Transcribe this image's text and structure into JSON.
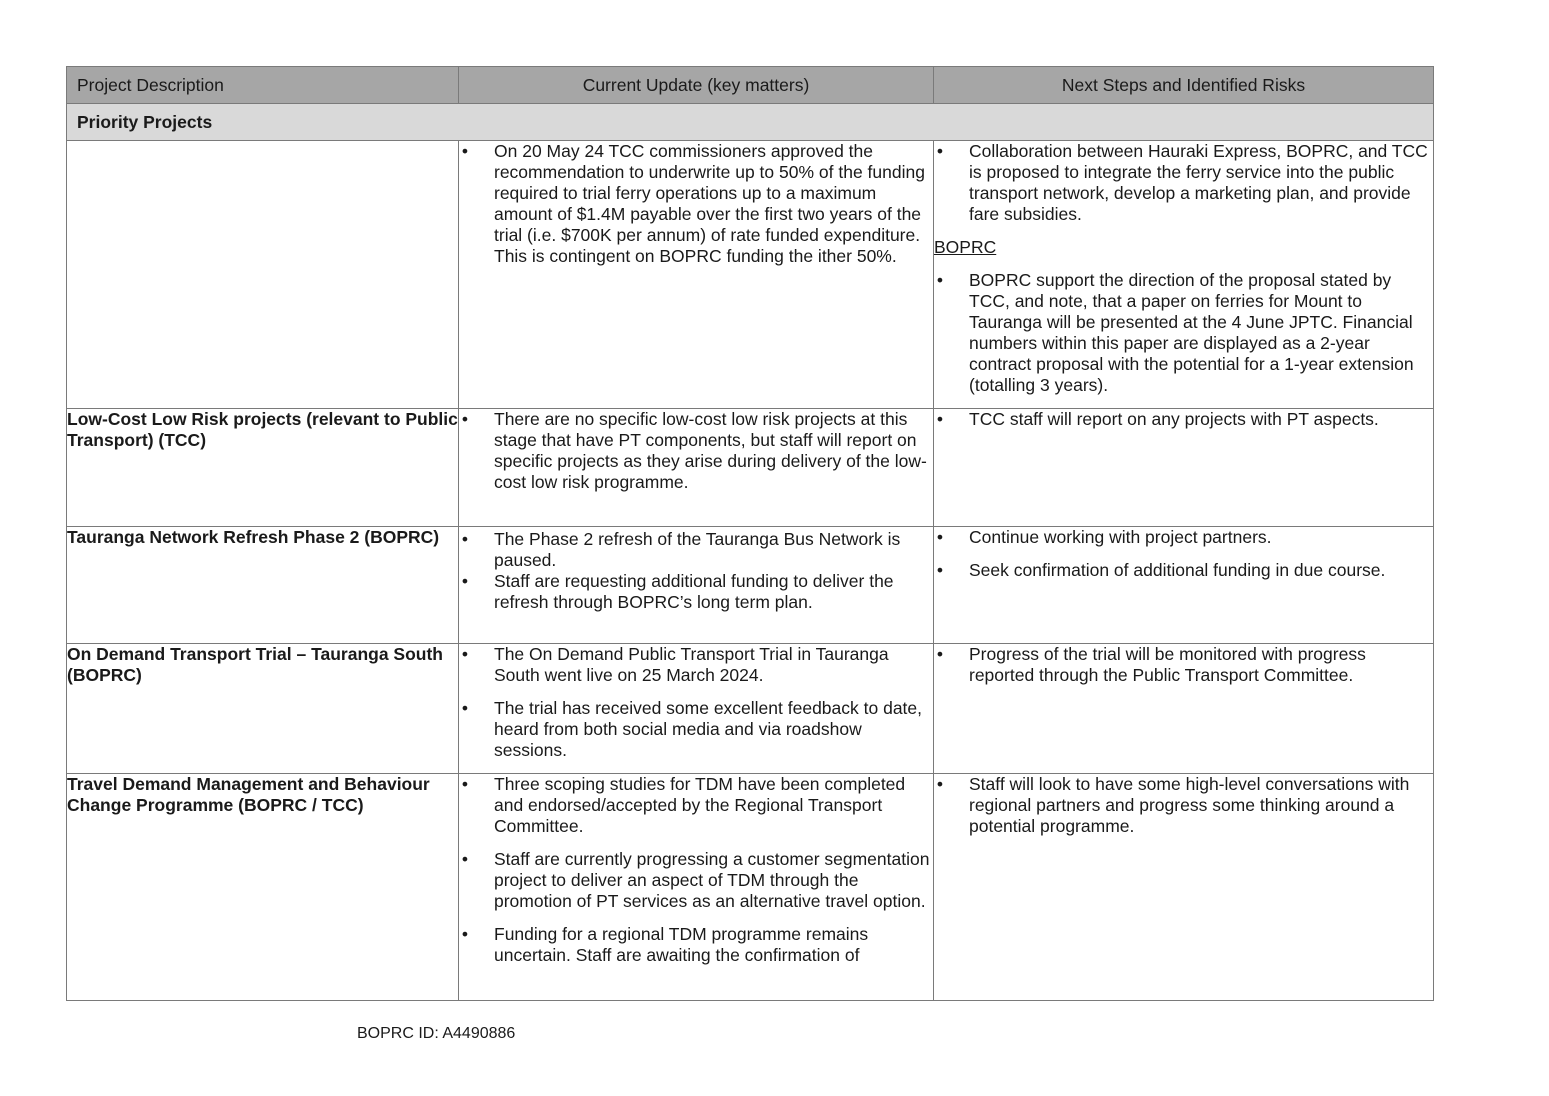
{
  "table": {
    "headers": {
      "col1": "Project Description",
      "col2": "Current Update (key matters)",
      "col3": "Next Steps and Identified Risks"
    },
    "section_title": "Priority Projects",
    "rows": [
      {
        "title": "",
        "updates": [
          "On 20 May 24 TCC commissioners approved the recommendation to underwrite up to 50% of the funding required to trial ferry operations up to a maximum amount of $1.4M payable over the first two years of the trial (i.e. $700K per annum) of rate funded expenditure.  This is contingent on BOPRC funding the ither 50%."
        ],
        "next_steps": [
          "Collaboration between Hauraki Express, BOPRC, and TCC is proposed to integrate the ferry service into the public transport network, develop a marketing plan, and provide fare subsidies."
        ],
        "sub_heading": "BOPRC",
        "next_steps_extra": [
          "BOPRC support the direction of the proposal stated by TCC, and note, that a paper on ferries for Mount to Tauranga will be presented at the 4 June JPTC. Financial numbers within this paper are displayed as a 2-year contract proposal with the potential for a 1-year extension (totalling 3 years)."
        ]
      },
      {
        "title": "Low-Cost Low Risk projects (relevant to Public Transport) (TCC)",
        "updates": [
          "There are no specific low-cost low risk projects at this stage that have PT components, but staff will report on specific projects as they arise during delivery of the low-cost low risk programme."
        ],
        "next_steps": [
          "TCC staff will report on any projects with PT aspects."
        ]
      },
      {
        "title": "Tauranga Network Refresh Phase 2 (BOPRC)",
        "updates": [
          "The Phase 2 refresh of the Tauranga Bus Network is paused.",
          "Staff are requesting additional funding to deliver the refresh through BOPRC’s long term plan."
        ],
        "next_steps": [
          "Continue working with project partners.",
          "Seek confirmation of additional funding in due course."
        ]
      },
      {
        "title": "On Demand Transport Trial – Tauranga South (BOPRC)",
        "updates": [
          "The On Demand Public Transport Trial in Tauranga South went live on 25 March 2024.",
          "The trial has received some excellent feedback to date, heard from both social media and via roadshow sessions."
        ],
        "next_steps": [
          "Progress of the trial will be monitored with progress reported through the Public Transport Committee."
        ]
      },
      {
        "title": "Travel Demand Management and Behaviour Change Programme (BOPRC / TCC)",
        "updates": [
          "Three scoping studies for TDM have been completed and endorsed/accepted by the Regional Transport Committee.",
          "Staff are currently progressing a customer segmentation project to deliver an aspect of TDM through the promotion of PT services as an alternative travel option.",
          "Funding for a regional TDM programme remains uncertain. Staff are awaiting the confirmation of"
        ],
        "next_steps": [
          "Staff will look to have some high-level conversations with regional partners and progress some thinking around a potential programme."
        ]
      }
    ]
  },
  "bullet_glyph": "•",
  "footer": {
    "doc_id": "BOPRC ID: A4490886"
  }
}
